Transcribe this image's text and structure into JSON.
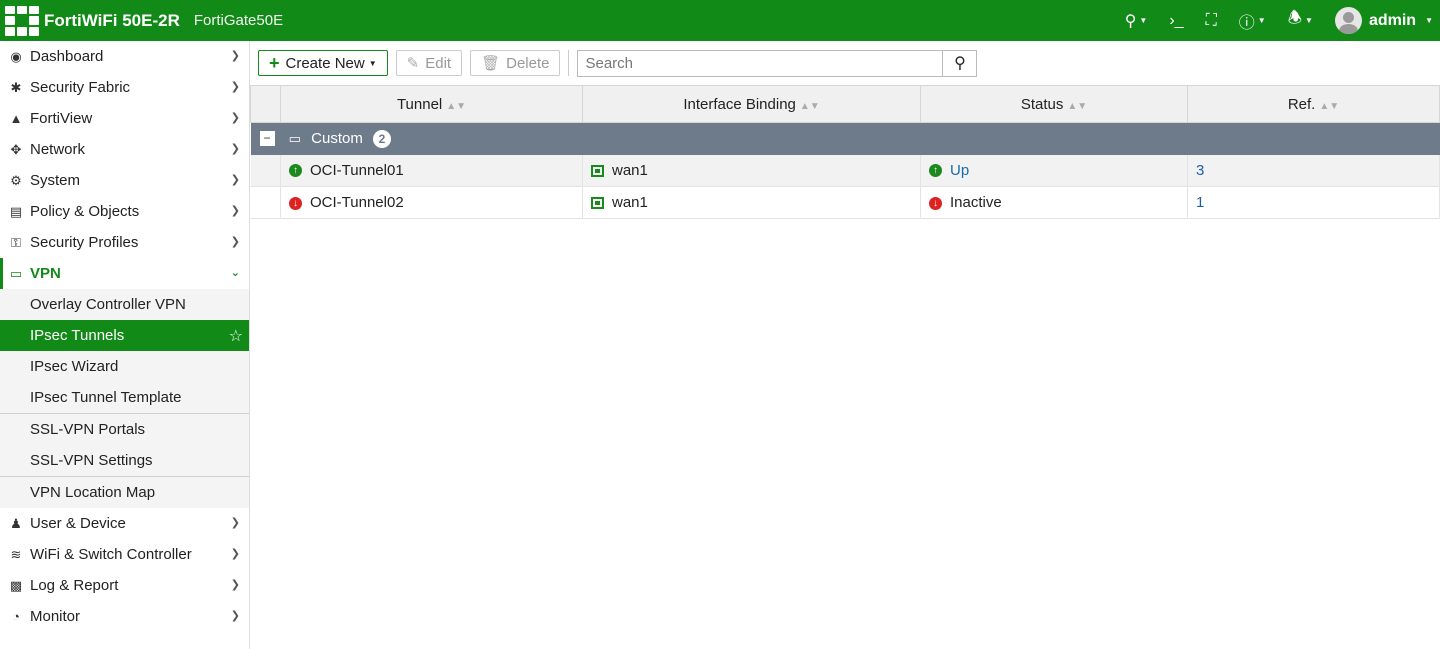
{
  "topbar": {
    "device": "FortiWiFi 50E-2R",
    "hostname": "FortiGate50E",
    "user": "admin"
  },
  "sidebar": {
    "items": [
      {
        "label": "Dashboard",
        "icon": "dashboard-icon"
      },
      {
        "label": "Security Fabric",
        "icon": "security-fabric-icon"
      },
      {
        "label": "FortiView",
        "icon": "fortiview-icon"
      },
      {
        "label": "Network",
        "icon": "network-icon"
      },
      {
        "label": "System",
        "icon": "gear-icon"
      },
      {
        "label": "Policy & Objects",
        "icon": "policy-icon"
      },
      {
        "label": "Security Profiles",
        "icon": "lock-icon"
      },
      {
        "label": "VPN",
        "icon": "laptop-icon"
      }
    ],
    "vpn_sub": [
      {
        "label": "Overlay Controller VPN"
      },
      {
        "label": "IPsec Tunnels"
      },
      {
        "label": "IPsec Wizard"
      },
      {
        "label": "IPsec Tunnel Template"
      },
      {
        "label": "SSL-VPN Portals"
      },
      {
        "label": "SSL-VPN Settings"
      },
      {
        "label": "VPN Location Map"
      }
    ],
    "items_after": [
      {
        "label": "User & Device",
        "icon": "user-icon"
      },
      {
        "label": "WiFi & Switch Controller",
        "icon": "wifi-icon"
      },
      {
        "label": "Log & Report",
        "icon": "chart-icon"
      },
      {
        "label": "Monitor",
        "icon": "pie-icon"
      }
    ]
  },
  "toolbar": {
    "create_label": "Create New",
    "edit_label": "Edit",
    "delete_label": "Delete",
    "search_placeholder": "Search"
  },
  "table": {
    "columns": [
      "Tunnel",
      "Interface Binding",
      "Status",
      "Ref."
    ],
    "group": {
      "label": "Custom",
      "count": "2"
    },
    "rows": [
      {
        "tunnel": "OCI-Tunnel01",
        "interface": "wan1",
        "status": "Up",
        "ref": "3"
      },
      {
        "tunnel": "OCI-Tunnel02",
        "interface": "wan1",
        "status": "Inactive",
        "ref": "1"
      }
    ]
  },
  "colors": {
    "brand": "#128a17",
    "group_header": "#6e7b8b",
    "status_up": "#1a8a1e",
    "status_down": "#dd2222"
  }
}
